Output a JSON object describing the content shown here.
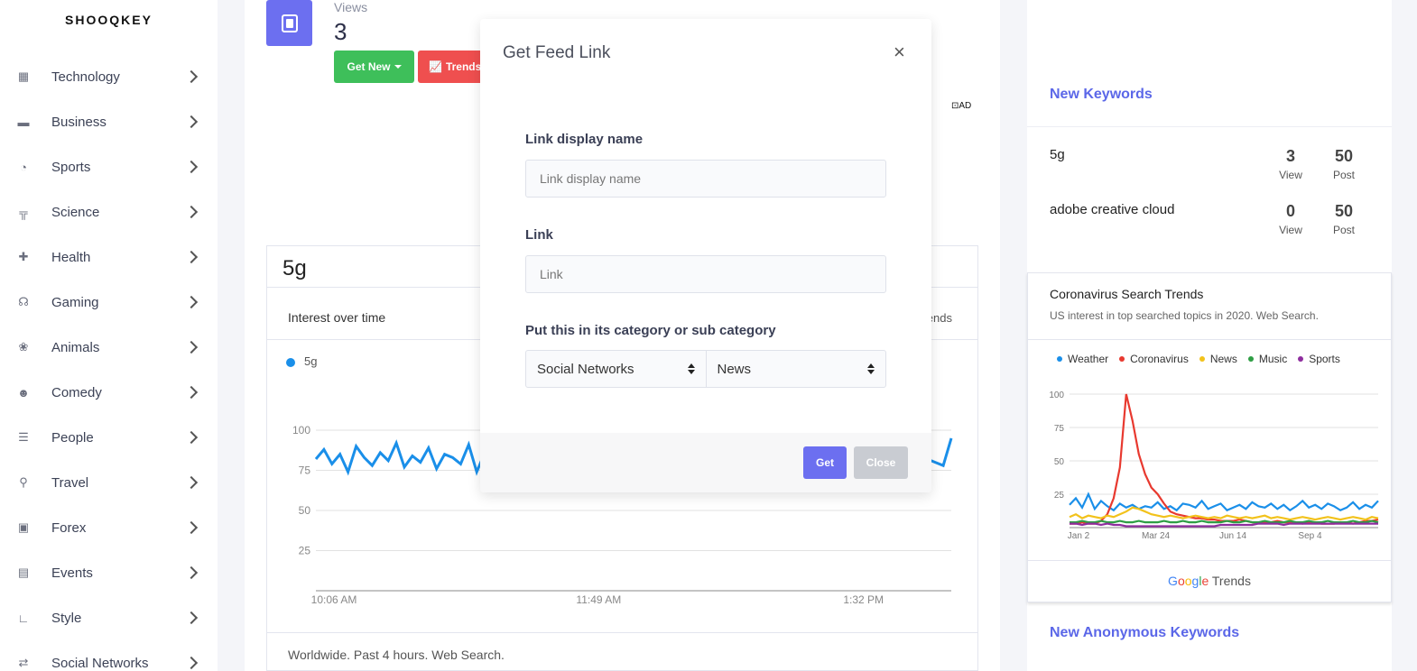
{
  "brand": "SHOOQKEY",
  "sidebar": {
    "items": [
      {
        "label": "Technology",
        "icon": "chip-icon",
        "glyph": "▦"
      },
      {
        "label": "Business",
        "icon": "briefcase-icon",
        "glyph": "▬"
      },
      {
        "label": "Sports",
        "icon": "volleyball-icon",
        "glyph": "◔"
      },
      {
        "label": "Science",
        "icon": "flask-icon",
        "glyph": "╦"
      },
      {
        "label": "Health",
        "icon": "medkit-icon",
        "glyph": "✚"
      },
      {
        "label": "Gaming",
        "icon": "headset-icon",
        "glyph": "☊"
      },
      {
        "label": "Animals",
        "icon": "paw-icon",
        "glyph": "❀"
      },
      {
        "label": "Comedy",
        "icon": "mask-icon",
        "glyph": "☻"
      },
      {
        "label": "People",
        "icon": "users-icon",
        "glyph": "☰"
      },
      {
        "label": "Travel",
        "icon": "route-icon",
        "glyph": "⚲"
      },
      {
        "label": "Forex",
        "icon": "money-icon",
        "glyph": "▣"
      },
      {
        "label": "Events",
        "icon": "calendar-icon",
        "glyph": "▤"
      },
      {
        "label": "Style",
        "icon": "ruler-icon",
        "glyph": "∟"
      },
      {
        "label": "Social Networks",
        "icon": "retweet-icon",
        "glyph": "⇄"
      }
    ]
  },
  "main": {
    "views_label": "Views",
    "views_value": "3",
    "get_new_label": "Get New",
    "trends_label": "Trends",
    "ad_label": "AD",
    "keyword": "5g",
    "trend_card": {
      "title": "Interest over time",
      "right_text": "ends",
      "legend": "5g",
      "footer": "Worldwide. Past 4 hours. Web Search."
    }
  },
  "right": {
    "new_keywords_title": "New Keywords",
    "keywords": [
      {
        "name": "5g",
        "view": "3",
        "view_label": "View",
        "post": "50",
        "post_label": "Post"
      },
      {
        "name": "adobe creative cloud",
        "view": "0",
        "view_label": "View",
        "post": "50",
        "post_label": "Post"
      }
    ],
    "cv_card": {
      "title": "Coronavirus Search Trends",
      "subtitle": "US interest in top searched topics in 2020. Web Search.",
      "footer_g": "Google",
      "footer_trends": "Trends"
    },
    "anon_title": "New Anonymous Keywords"
  },
  "modal": {
    "title": "Get Feed Link",
    "close_glyph": "×",
    "name_label": "Link display name",
    "name_placeholder": "Link display name",
    "link_label": "Link",
    "link_placeholder": "Link",
    "category_label": "Put this in its category or sub category",
    "category_value": "Social Networks",
    "subcategory_value": "News",
    "get_label": "Get",
    "close_label": "Close"
  },
  "colors": {
    "accent": "#6c6ff0",
    "green": "#3ebf5a",
    "red": "#ef4f4f",
    "link": "#5b67e8"
  },
  "chart_data": [
    {
      "type": "line",
      "title": "Interest over time",
      "xlabel": "",
      "ylabel": "",
      "x_ticks": [
        "10:06 AM",
        "11:49 AM",
        "1:32 PM"
      ],
      "y_ticks": [
        25,
        50,
        75,
        100
      ],
      "ylim": [
        0,
        100
      ],
      "grid": true,
      "series": [
        {
          "name": "5g",
          "color": "#1a8fe9",
          "values": [
            82,
            88,
            79,
            85,
            74,
            90,
            83,
            78,
            86,
            81,
            92,
            77,
            84,
            80,
            89,
            76,
            85,
            83,
            79,
            91,
            74,
            86,
            82,
            88,
            78,
            84,
            80,
            93,
            75,
            87,
            81,
            85,
            72,
            88,
            79,
            84,
            77,
            90,
            82,
            86,
            70,
            80,
            75,
            84,
            78,
            82,
            76,
            88,
            80,
            85,
            79,
            83,
            77,
            90,
            81,
            86,
            74,
            88,
            80,
            84,
            78,
            86,
            82,
            89,
            76,
            85,
            80,
            83,
            79,
            91,
            77,
            84,
            81,
            86,
            74,
            88,
            82,
            80,
            78,
            95
          ]
        }
      ]
    },
    {
      "type": "line",
      "title": "Coronavirus Search Trends",
      "x_ticks": [
        "Jan 2",
        "Mar 24",
        "Jun 14",
        "Sep 4"
      ],
      "y_ticks": [
        25,
        50,
        75,
        100
      ],
      "ylim": [
        0,
        100
      ],
      "grid": true,
      "legend_position": "top",
      "series": [
        {
          "name": "Weather",
          "color": "#1a8fe9",
          "values": [
            17,
            22,
            15,
            25,
            14,
            20,
            16,
            13,
            18,
            15,
            17,
            14,
            16,
            15,
            19,
            14,
            16,
            13,
            18,
            17,
            15,
            20,
            14,
            16,
            18,
            13,
            15,
            17,
            14,
            19,
            16,
            15,
            18,
            14,
            17,
            13,
            16,
            20,
            15,
            17,
            14,
            18,
            16,
            13,
            15,
            19,
            14,
            17,
            15,
            20
          ]
        },
        {
          "name": "Coronavirus",
          "color": "#e8392f",
          "values": [
            3,
            3,
            4,
            3,
            3,
            5,
            10,
            22,
            45,
            100,
            80,
            55,
            40,
            30,
            25,
            18,
            12,
            10,
            9,
            8,
            7,
            7,
            6,
            6,
            5,
            5,
            5,
            6,
            5,
            4,
            4,
            4,
            4,
            5,
            4,
            4,
            4,
            3,
            4,
            4,
            3,
            3,
            3,
            4,
            4,
            3,
            4,
            5,
            5,
            6
          ]
        },
        {
          "name": "News",
          "color": "#f2c21b",
          "values": [
            8,
            10,
            7,
            9,
            8,
            7,
            9,
            8,
            10,
            12,
            15,
            14,
            12,
            10,
            9,
            8,
            9,
            8,
            7,
            8,
            9,
            8,
            7,
            8,
            7,
            9,
            8,
            7,
            8,
            7,
            8,
            9,
            7,
            8,
            7,
            6,
            7,
            8,
            7,
            6,
            7,
            8,
            7,
            6,
            7,
            8,
            7,
            6,
            8,
            7
          ]
        },
        {
          "name": "Music",
          "color": "#2e9e44",
          "values": [
            4,
            4,
            5,
            4,
            4,
            5,
            4,
            4,
            5,
            4,
            4,
            5,
            4,
            4,
            4,
            5,
            4,
            4,
            5,
            4,
            4,
            5,
            4,
            4,
            4,
            5,
            4,
            4,
            5,
            4,
            4,
            5,
            4,
            4,
            4,
            5,
            4,
            4,
            5,
            4,
            4,
            5,
            4,
            4,
            4,
            5,
            4,
            4,
            5,
            4
          ]
        },
        {
          "name": "Sports",
          "color": "#8e2d9e",
          "values": [
            3,
            3,
            2,
            3,
            3,
            2,
            3,
            2,
            2,
            1,
            1,
            1,
            1,
            1,
            1,
            1,
            1,
            1,
            1,
            1,
            1,
            1,
            1,
            1,
            2,
            2,
            2,
            2,
            2,
            2,
            3,
            3,
            3,
            3,
            2,
            3,
            3,
            3,
            3,
            3,
            3,
            3,
            3,
            3,
            3,
            3,
            3,
            3,
            3,
            3
          ]
        }
      ]
    }
  ]
}
